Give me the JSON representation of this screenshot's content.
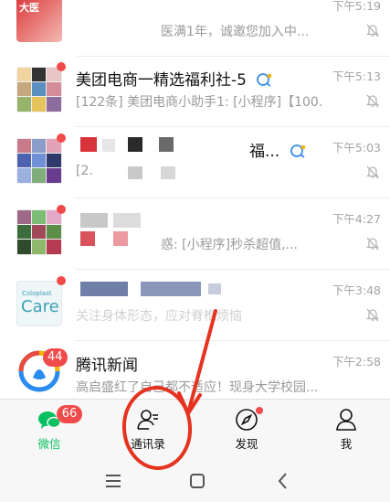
{
  "colors": {
    "accent_green": "#07c160",
    "badge_red": "#f04b4b",
    "annotation_red": "#e53320"
  },
  "chats": [
    {
      "title": "",
      "preview": "医满1年，诚邀您加入中...",
      "time": "下午5:19",
      "avatar_text": "大医",
      "muted": true
    },
    {
      "title": "美团电商一精选福利社-5",
      "preview": "[122条] 美团电商小助手1: [小程序]【100...",
      "time": "下午5:13",
      "muted": true,
      "unread_dot": true
    },
    {
      "title": "福...",
      "preview": "[2...",
      "time": "下午5:03",
      "muted": true,
      "unread_dot": true
    },
    {
      "title": "",
      "preview": "惑: [小程序]秒杀超值,...",
      "time": "下午4:27",
      "muted": true,
      "unread_dot": true
    },
    {
      "title": "",
      "preview": "关注身体形态，应对脊椎烦恼",
      "time": "下午3:48",
      "avatar_text": "Coloplast",
      "avatar_brand": "Care",
      "muted": true,
      "unread_dot": true
    },
    {
      "title": "腾讯新闻",
      "preview": "高启盛红了自己都不适应！现身大学校园...",
      "time": "下午2:58",
      "unread_count": "44"
    }
  ],
  "tabs": [
    {
      "label": "微信",
      "icon": "chat-bubbles-icon",
      "badge": "66",
      "active": true
    },
    {
      "label": "通讯录",
      "icon": "contacts-icon"
    },
    {
      "label": "发现",
      "icon": "compass-icon",
      "dot": true
    },
    {
      "label": "我",
      "icon": "person-icon"
    }
  ],
  "system_nav": [
    "menu-icon",
    "home-square-icon",
    "back-chevron-icon"
  ]
}
